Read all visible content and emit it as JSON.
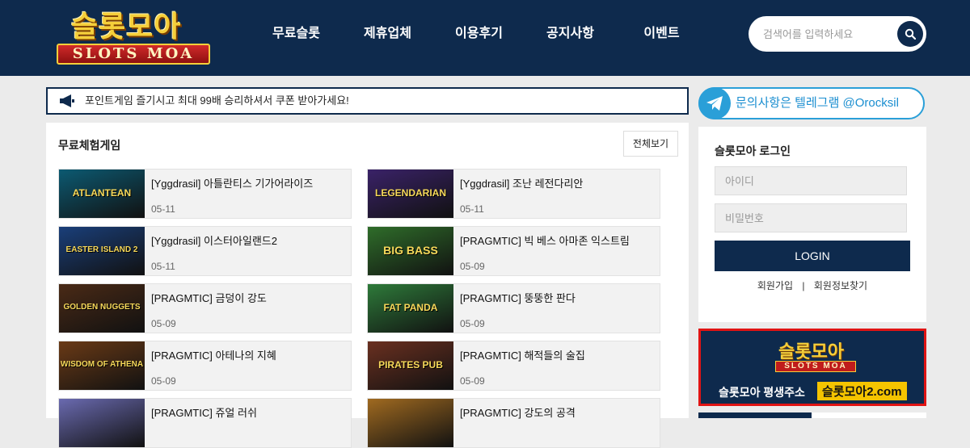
{
  "header": {
    "logo_top": "슬롯모아",
    "logo_ribbon": "SLOTS MOA",
    "nav": [
      "무료슬롯",
      "제휴업체",
      "이용후기",
      "공지사항",
      "이벤트"
    ],
    "search_placeholder": "검색어를 입력하세요"
  },
  "notice": {
    "text": "포인트게임 즐기시고 최대 99배 승리하셔서 쿠폰 받아가세요!"
  },
  "games": {
    "title": "무료체험게임",
    "more_label": "전체보기",
    "items": [
      {
        "title": "[Yggdrasil] 아틀란티스 기가어라이즈",
        "date": "05-11",
        "thumb_text": "ATLANTEAN",
        "thumb_color": "#0c5a72"
      },
      {
        "title": "[Yggdrasil] 조난 레전다리안",
        "date": "05-11",
        "thumb_text": "LEGENDARIAN",
        "thumb_color": "#3a2268"
      },
      {
        "title": "[Yggdrasil] 이스터아일랜드2",
        "date": "05-11",
        "thumb_text": "EASTER ISLAND 2",
        "thumb_color": "#1a3f7a"
      },
      {
        "title": "[PRAGMTIC] 빅 베스 아마존 익스트림",
        "date": "05-09",
        "thumb_text": "BIG BASS",
        "thumb_color": "#2f6d2a"
      },
      {
        "title": "[PRAGMTIC] 금덩이 강도",
        "date": "05-09",
        "thumb_text": "GOLDEN NUGGETS",
        "thumb_color": "#4a2a16"
      },
      {
        "title": "[PRAGMTIC] 뚱뚱한 판다",
        "date": "05-09",
        "thumb_text": "FAT PANDA",
        "thumb_color": "#2e7a3a"
      },
      {
        "title": "[PRAGMTIC] 아테나의 지혜",
        "date": "05-09",
        "thumb_text": "WISDOM OF ATHENA",
        "thumb_color": "#6a3a16"
      },
      {
        "title": "[PRAGMTIC] 해적들의 술집",
        "date": "05-09",
        "thumb_text": "PIRATES PUB",
        "thumb_color": "#6a3020"
      },
      {
        "title": "[PRAGMTIC] 쥬얼 러쉬",
        "date": "",
        "thumb_text": "",
        "thumb_color": "#6a6ab0"
      },
      {
        "title": "[PRAGMTIC] 강도의 공격",
        "date": "",
        "thumb_text": "",
        "thumb_color": "#a06a20"
      }
    ]
  },
  "sidebar": {
    "telegram_text": "문의사항은 텔레그램 @Orocksil",
    "login_title": "슬롯모아 로그인",
    "id_placeholder": "아이디",
    "pw_placeholder": "비밀번호",
    "login_label": "LOGIN",
    "signup_label": "회원가입",
    "divider": "|",
    "find_label": "회원정보찾기",
    "banner_top": "슬롯모아",
    "banner_ribbon": "SLOTS MOA",
    "banner_text": "슬롯모아 평생주소",
    "banner_url": "슬롯모아2.com"
  },
  "colors": {
    "brand_navy": "#0e2a4d",
    "telegram_blue": "#2a9fd8",
    "banner_red": "#e01414",
    "gold": "#f5cf3a"
  }
}
